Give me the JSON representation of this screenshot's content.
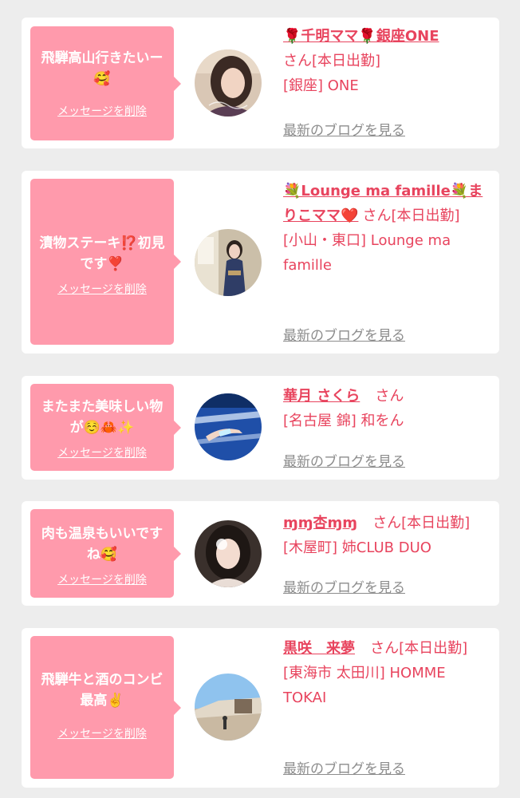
{
  "delete_label": "メッセージを削除",
  "blog_label": "最新のブログを見る",
  "messages": [
    {
      "message": "飛騨高山行きたいー🥰",
      "name": "🌹千明ママ🌹銀座ONE",
      "san": "さん[本日出勤]",
      "area_shop": "[銀座] ONE"
    },
    {
      "message": "漬物ステーキ⁉️初見です❣️",
      "name": "💐Lounge ma famille💐まりこママ❤️",
      "san": "さん[本日出勤]",
      "area_shop": "[小山・東口] Lounge ma famille"
    },
    {
      "message": "またまた美味しい物が☺️🦀✨",
      "name": "華月 さくら",
      "san": "さん",
      "area_shop": "[名古屋 錦] 和をん"
    },
    {
      "message": "肉も温泉もいいですね🥰",
      "name": "ɱɱ杏ɱɱ",
      "san": "さん[本日出勤]",
      "area_shop": "[木屋町] 姉CLUB DUO"
    },
    {
      "message": "飛騨牛と酒のコンビ最高✌️",
      "name": "黒咲　来夢",
      "san": "さん[本日出勤]",
      "area_shop": "[東海市 太田川] HOMME TOKAI"
    }
  ]
}
